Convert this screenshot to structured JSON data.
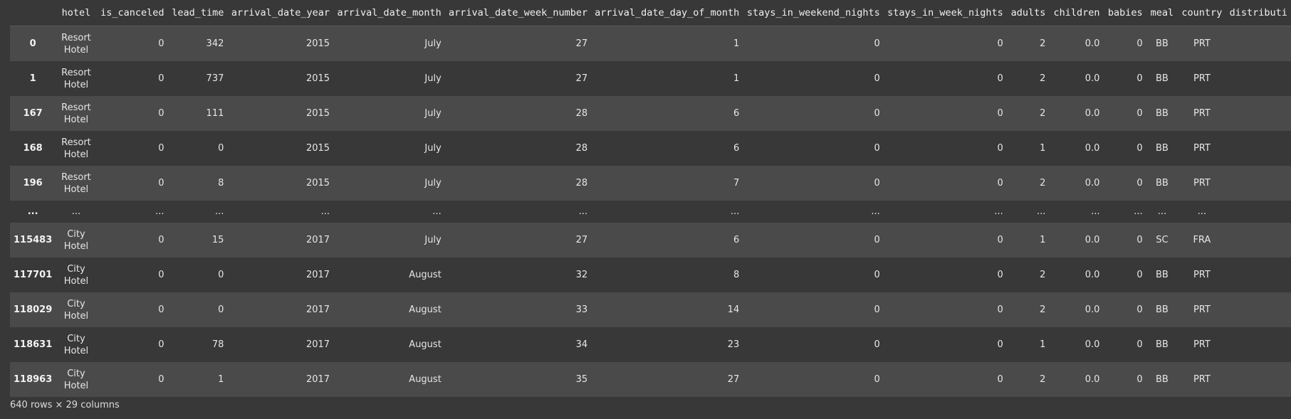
{
  "columns": [
    "",
    "hotel",
    "is_canceled",
    "lead_time",
    "arrival_date_year",
    "arrival_date_month",
    "arrival_date_week_number",
    "arrival_date_day_of_month",
    "stays_in_weekend_nights",
    "stays_in_week_nights",
    "adults",
    "children",
    "babies",
    "meal",
    "country",
    "distributi"
  ],
  "rows": [
    [
      "0",
      "Resort Hotel",
      "0",
      "342",
      "2015",
      "July",
      "27",
      "1",
      "0",
      "0",
      "2",
      "0.0",
      "0",
      "BB",
      "PRT",
      ""
    ],
    [
      "1",
      "Resort Hotel",
      "0",
      "737",
      "2015",
      "July",
      "27",
      "1",
      "0",
      "0",
      "2",
      "0.0",
      "0",
      "BB",
      "PRT",
      ""
    ],
    [
      "167",
      "Resort Hotel",
      "0",
      "111",
      "2015",
      "July",
      "28",
      "6",
      "0",
      "0",
      "2",
      "0.0",
      "0",
      "BB",
      "PRT",
      ""
    ],
    [
      "168",
      "Resort Hotel",
      "0",
      "0",
      "2015",
      "July",
      "28",
      "6",
      "0",
      "0",
      "1",
      "0.0",
      "0",
      "BB",
      "PRT",
      ""
    ],
    [
      "196",
      "Resort Hotel",
      "0",
      "8",
      "2015",
      "July",
      "28",
      "7",
      "0",
      "0",
      "2",
      "0.0",
      "0",
      "BB",
      "PRT",
      ""
    ],
    [
      "...",
      "...",
      "...",
      "...",
      "...",
      "...",
      "...",
      "...",
      "...",
      "...",
      "...",
      "...",
      "...",
      "...",
      "...",
      ""
    ],
    [
      "115483",
      "City Hotel",
      "0",
      "15",
      "2017",
      "July",
      "27",
      "6",
      "0",
      "0",
      "1",
      "0.0",
      "0",
      "SC",
      "FRA",
      ""
    ],
    [
      "117701",
      "City Hotel",
      "0",
      "0",
      "2017",
      "August",
      "32",
      "8",
      "0",
      "0",
      "2",
      "0.0",
      "0",
      "BB",
      "PRT",
      ""
    ],
    [
      "118029",
      "City Hotel",
      "0",
      "0",
      "2017",
      "August",
      "33",
      "14",
      "0",
      "0",
      "2",
      "0.0",
      "0",
      "BB",
      "PRT",
      ""
    ],
    [
      "118631",
      "City Hotel",
      "0",
      "78",
      "2017",
      "August",
      "34",
      "23",
      "0",
      "0",
      "1",
      "0.0",
      "0",
      "BB",
      "PRT",
      ""
    ],
    [
      "118963",
      "City Hotel",
      "0",
      "1",
      "2017",
      "August",
      "35",
      "27",
      "0",
      "0",
      "2",
      "0.0",
      "0",
      "BB",
      "PRT",
      ""
    ]
  ],
  "footer": "640 rows × 29 columns"
}
